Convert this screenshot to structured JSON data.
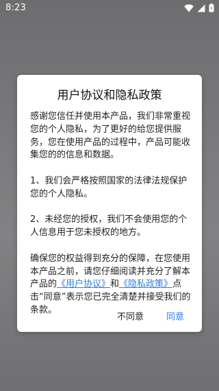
{
  "status_bar": {
    "time": "8:23"
  },
  "dialog": {
    "title": "用户协议和隐私政策",
    "para1": "感谢您信任并使用本产品，我们非常重视您的个人隐私，为了更好的给您提供服务，您在使用产品的过程中，产品可能收集您的的信息和数据。",
    "para2": "1、我们会严格按照国家的法律法规保护您的个人隐私。",
    "para3": "2、未经您的授权，我们不会使用您的个人信息用于您未授权的地方。",
    "para4_prefix": "确保您的权益得到充分的保障，在您使用本产品之前，请您仔细阅读并充分了解本产品的",
    "link_user_agreement": "《用户协议》",
    "para4_and": "和",
    "link_privacy_policy": "《隐私政策》",
    "para4_suffix": "点击“同意”表示您已完全清楚并接受我们的条款。",
    "disagree_label": "不同意",
    "agree_label": "同意"
  },
  "colors": {
    "accent": "#2f7fe0",
    "overlay": "#7a7a7c"
  }
}
